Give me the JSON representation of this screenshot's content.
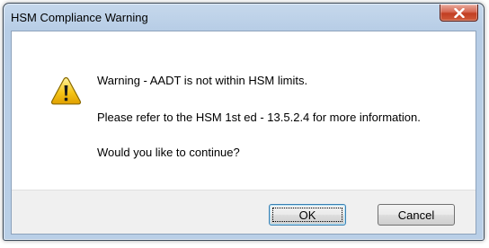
{
  "window": {
    "title": "HSM Compliance Warning"
  },
  "message": {
    "line1": "Warning - AADT is not within HSM limits.",
    "line2": "Please refer to the HSM 1st ed - 13.5.2.4 for more information.",
    "line3": "Would you like to continue?"
  },
  "buttons": {
    "ok_label": "OK",
    "cancel_label": "Cancel"
  },
  "icons": {
    "title_close": "close-icon",
    "message": "warning-icon"
  },
  "colors": {
    "close_button": "#c23e22",
    "warning_fill": "#f5c518",
    "frame": "#b9cfe7"
  }
}
